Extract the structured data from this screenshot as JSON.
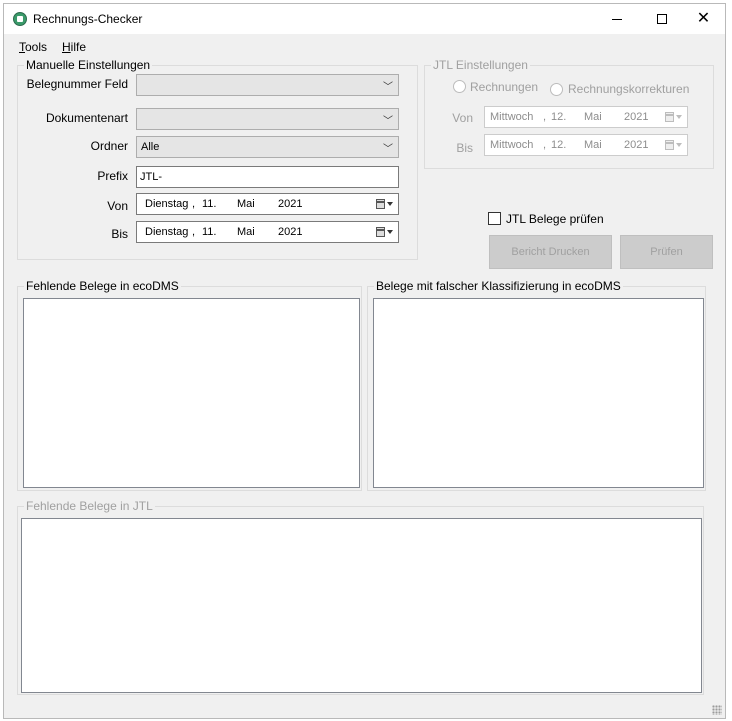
{
  "window": {
    "title": "Rechnungs-Checker"
  },
  "menu": {
    "tools_mnemonic": "T",
    "tools_rest": "ools",
    "hilfe_mnemonic": "H",
    "hilfe_rest": "ilfe"
  },
  "manual": {
    "legend": "Manuelle Einstellungen",
    "belegnummer_label": "Belegnummer Feld",
    "belegnummer_value": "",
    "dokumentenart_label": "Dokumentenart",
    "dokumentenart_value": "",
    "ordner_label": "Ordner",
    "ordner_value": "Alle",
    "prefix_label": "Prefix",
    "prefix_value": "JTL-",
    "von_label": "Von",
    "von_date": {
      "weekday": "Dienstag",
      "sep": ",",
      "day": "11.",
      "month": "Mai",
      "year": "2021"
    },
    "bis_label": "Bis",
    "bis_date": {
      "weekday": "Dienstag",
      "sep": ",",
      "day": "11.",
      "month": "Mai",
      "year": "2021"
    }
  },
  "jtl": {
    "legend": "JTL Einstellungen",
    "radio_rechnungen": "Rechnungen",
    "radio_korrekturen": "Rechnungskorrekturen",
    "von_label": "Von",
    "von_date": {
      "weekday": "Mittwoch",
      "sep": ",",
      "day": "12.",
      "month": "Mai",
      "year": "2021"
    },
    "bis_label": "Bis",
    "bis_date": {
      "weekday": "Mittwoch",
      "sep": ",",
      "day": "12.",
      "month": "Mai",
      "year": "2021"
    }
  },
  "actions": {
    "jtl_pruefen_label": "JTL Belege prüfen",
    "bericht_label": "Bericht Drucken",
    "pruefen_label": "Prüfen"
  },
  "lists": {
    "fehlende_ecodms": "Fehlende Belege in ecoDMS",
    "falsche_klassifizierung": "Belege mit falscher Klassifizierung in ecoDMS",
    "fehlende_jtl": "Fehlende Belege in JTL"
  },
  "colors": {
    "window_bg": "#f0f0f0",
    "disabled_text": "#a0a0a0",
    "button_disabled_bg": "#cccccc"
  }
}
